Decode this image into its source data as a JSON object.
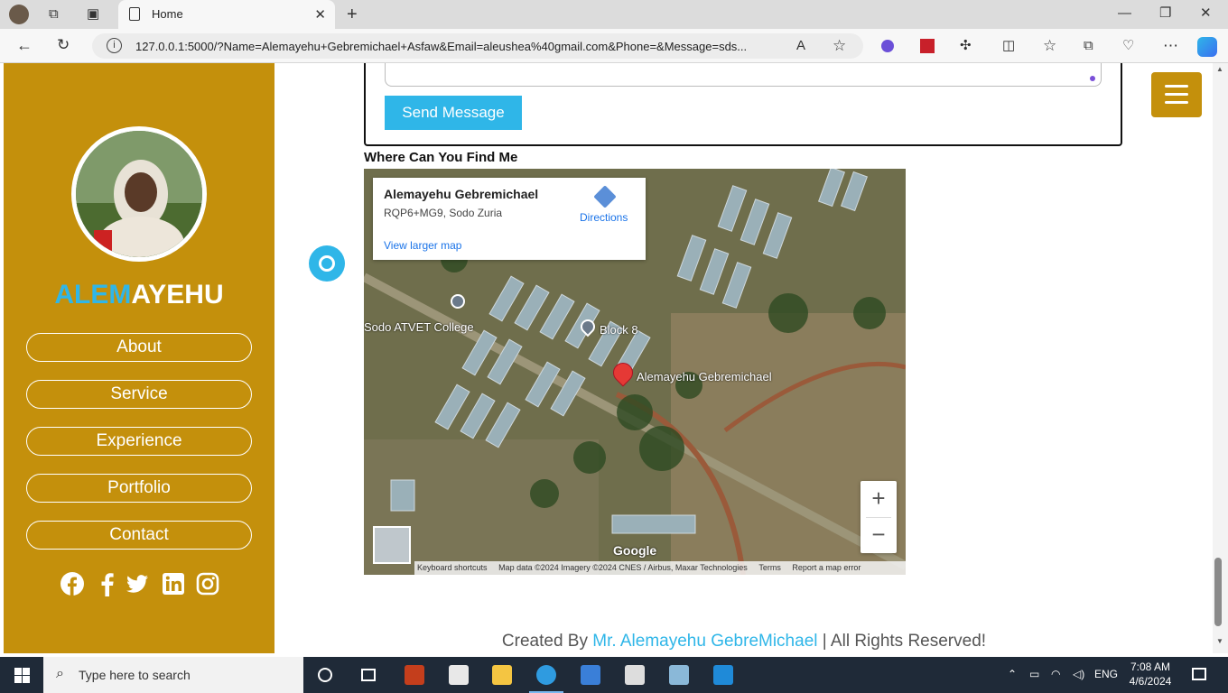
{
  "browser": {
    "tab_title": "Home",
    "url": "127.0.0.1:5000/?Name=Alemayehu+Gebremichael+Asfaw&Email=aleushea%40gmail.com&Phone=&Message=sds..."
  },
  "sidebar": {
    "brand_highlight": "ALEM",
    "brand_rest": "AYEHU",
    "nav": [
      "About",
      "Service",
      "Experience",
      "Portfolio",
      "Contact"
    ],
    "socials": [
      "facebook-icon",
      "facebook-f-icon",
      "twitter-icon",
      "linkedin-icon",
      "instagram-icon"
    ]
  },
  "contact": {
    "send_label": "Send Message"
  },
  "map": {
    "heading": "Where Can You Find Me",
    "card_title": "Alemayehu Gebremichael",
    "card_address": "RQP6+MG9, Sodo Zuria",
    "directions": "Directions",
    "view_larger": "View larger map",
    "labels": {
      "college": "Sodo ATVET College",
      "block": "Block 8",
      "pin": "Alemayehu Gebremichael"
    },
    "logo": "Google",
    "attribution": [
      "Keyboard shortcuts",
      "Map data ©2024 Imagery ©2024 CNES / Airbus, Maxar Technologies",
      "Terms",
      "Report a map error"
    ],
    "zoom_in": "+",
    "zoom_out": "−"
  },
  "footer": {
    "prefix": "Created By ",
    "author": "Mr. Alemayehu GebreMichael",
    "suffix": " | All Rights Reserved!"
  },
  "taskbar": {
    "search_placeholder": "Type here to search",
    "lang": "ENG",
    "time": "7:08 AM",
    "date": "4/6/2024"
  },
  "colors": {
    "sidebar": "#c4900c",
    "accent": "#2fb6e8"
  }
}
